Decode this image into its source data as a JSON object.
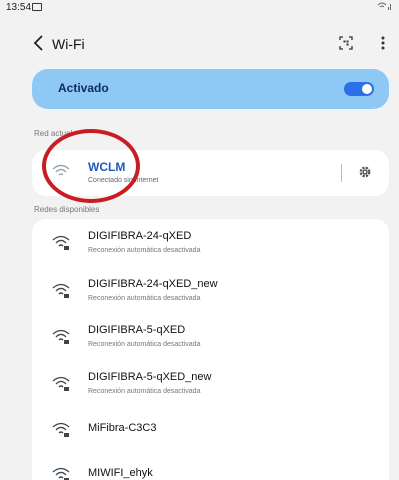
{
  "status_bar": {
    "time": "13:54",
    "icons": "📶⁠.ıl"
  },
  "header": {
    "back_icon": "back-arrow",
    "title": "Wi-Fi",
    "qr_icon": "qr-scan",
    "more_icon": "more-vert"
  },
  "toggle": {
    "label": "Activado",
    "on": true,
    "accent": "#2d6fe8"
  },
  "current_network": {
    "header": "Red actual",
    "name": "WCLM",
    "status": "Conectado sin Internet",
    "name_color": "#1e5bb8"
  },
  "available": {
    "header": "Redes disponibles",
    "networks": [
      {
        "name": "DIGIFIBRA-24-qXED",
        "status": "Reconexión automática desactivada"
      },
      {
        "name": "DIGIFIBRA-24-qXED_new",
        "status": "Reconexión automática desactivada"
      },
      {
        "name": "DIGIFIBRA-5-qXED",
        "status": "Reconexión automática desactivada"
      },
      {
        "name": "DIGIFIBRA-5-qXED_new",
        "status": "Reconexión automática desactivada"
      },
      {
        "name": "MiFibra-C3C3",
        "status": ""
      },
      {
        "name": "MIWIFI_ehyk",
        "status": ""
      }
    ]
  },
  "annotation_color": "#c91d24"
}
